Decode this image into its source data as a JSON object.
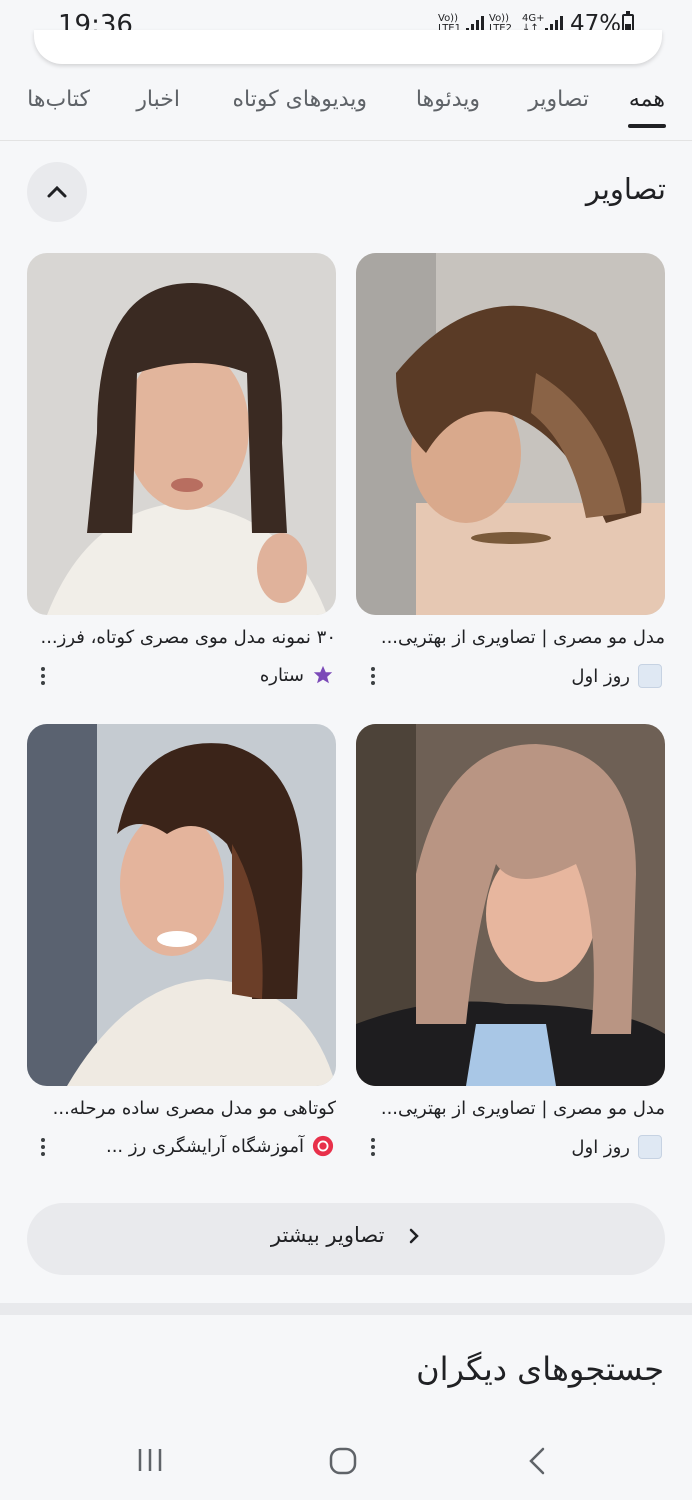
{
  "status_bar": {
    "time": "19:36",
    "sim1_label_top": "Vo))",
    "sim1_label_bottom": "LTE1",
    "sim2_label_top": "Vo))",
    "sim2_label_bottom": "LTE2",
    "network_label_top": "4G+",
    "network_label_bottom": "↓↑",
    "battery_percent": "47%"
  },
  "tabs": [
    {
      "label": "همه",
      "active": true
    },
    {
      "label": "تصاویر",
      "active": false
    },
    {
      "label": "ویدئوها",
      "active": false
    },
    {
      "label": "ویدیوهای کوتاه",
      "active": false
    },
    {
      "label": "اخبار",
      "active": false
    },
    {
      "label": "کتاب‌ها",
      "active": false
    }
  ],
  "images_section": {
    "title": "تصاویر",
    "collapse_icon": "chevron-up-icon",
    "results": [
      {
        "caption": "مدل مو مصری | تصاویری از بهتریی...",
        "source": "روز اول",
        "favicon": "rooz-aval-icon"
      },
      {
        "caption": "۳۰ نمونه مدل موی مصری کوتاه، فرز...",
        "source": "ستاره",
        "favicon": "setare-star-icon"
      },
      {
        "caption": "مدل مو مصری | تصاویری از بهتریی...",
        "source": "روز اول",
        "favicon": "rooz-aval-icon"
      },
      {
        "caption": "کوتاهی مو مدل مصری ساده مرحله...",
        "source": "آموزشگاه آرایشگری رز ...",
        "favicon": "rose-icon"
      }
    ],
    "more_button": "تصاویر بیشتر"
  },
  "other_searches": {
    "title": "جستجوهای دیگران"
  },
  "colors": {
    "background": "#f6f7f9",
    "button_bg": "#e9eaed",
    "text": "#202124",
    "muted": "#5f6368"
  }
}
